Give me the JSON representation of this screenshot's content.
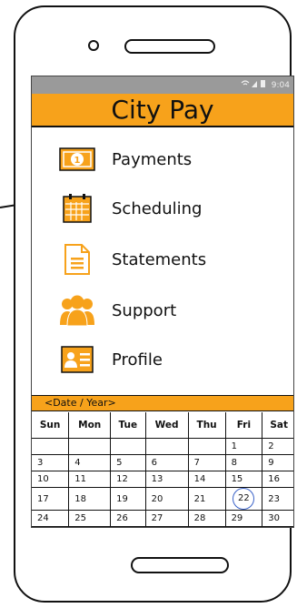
{
  "status": {
    "time": "9:04",
    "icons": "wifi signal battery"
  },
  "app": {
    "title": "City Pay"
  },
  "menu": [
    {
      "label": "Payments",
      "icon": "money-icon"
    },
    {
      "label": "Scheduling",
      "icon": "calendar-icon"
    },
    {
      "label": "Statements",
      "icon": "document-icon"
    },
    {
      "label": "Support",
      "icon": "people-icon"
    },
    {
      "label": "Profile",
      "icon": "id-card-icon"
    }
  ],
  "calendar": {
    "header_label": "<Date / Year>",
    "days": [
      "Sun",
      "Mon",
      "Tue",
      "Wed",
      "Thu",
      "Fri",
      "Sat"
    ],
    "weeks": [
      [
        "",
        "",
        "",
        "",
        "",
        "1",
        "2"
      ],
      [
        "3",
        "4",
        "5",
        "6",
        "7",
        "8",
        "9"
      ],
      [
        "10",
        "11",
        "12",
        "13",
        "14",
        "15",
        "16"
      ],
      [
        "17",
        "18",
        "19",
        "20",
        "21",
        "22",
        "23"
      ],
      [
        "24",
        "25",
        "26",
        "27",
        "28",
        "29",
        "30"
      ]
    ],
    "today": "22"
  },
  "colors": {
    "accent": "#f7a21b",
    "today_ring": "#3a62c8",
    "statusbar": "#9a9a9a"
  }
}
